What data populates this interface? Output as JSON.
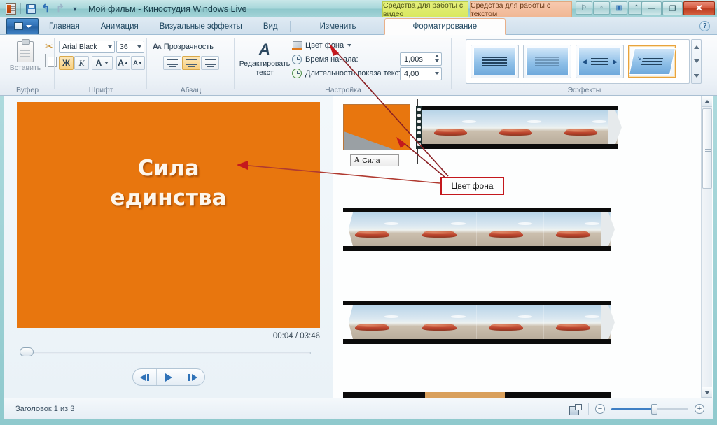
{
  "window": {
    "title": "Мой фильм - Киностудия Windows Live",
    "quick_access": [
      "save-icon",
      "undo-icon",
      "redo-icon",
      "customize-caret-icon"
    ],
    "controls": {
      "pin": "pin-icon",
      "restore_small": "restore-small-icon",
      "display": "display-icon",
      "collapse_ribbon": "collapse-ribbon-icon",
      "minimize": "—",
      "maximize": "❐",
      "close": "✕"
    }
  },
  "contextual_tabs": [
    {
      "label": "Средства для работы с видео",
      "color": "#d9e85f"
    },
    {
      "label": "Средства для работы с текстом",
      "color": "#f0b794"
    }
  ],
  "tabs": [
    {
      "label": "Главная",
      "active": false
    },
    {
      "label": "Анимация",
      "active": false
    },
    {
      "label": "Визуальные эффекты",
      "active": false
    },
    {
      "label": "Вид",
      "active": false
    },
    {
      "label": "Изменить",
      "active": false
    },
    {
      "label": "Форматирование",
      "active": true
    }
  ],
  "help_icon": "?",
  "ribbon": {
    "groups": [
      {
        "label": "Буфер"
      },
      {
        "label": "Шрифт"
      },
      {
        "label": "Абзац"
      },
      {
        "label": "Настройка"
      },
      {
        "label": "Эффекты"
      }
    ],
    "clipboard": {
      "paste_label": "Вставить",
      "cut_icon": "scissors-icon",
      "copy_icon": "copy-icon"
    },
    "font": {
      "font_name": "Arial Black",
      "font_size": "36",
      "bold_label": "Ж",
      "italic_label": "К",
      "font_color_label": "A",
      "grow_label": "A",
      "shrink_label": "A",
      "bold_active": true
    },
    "paragraph": {
      "transparency_label": "Прозрачность",
      "align_left": "align-left-icon",
      "align_center": "align-center-icon",
      "align_right": "align-right-icon",
      "align_center_active": true
    },
    "settings": {
      "edit_text_line1": "Редактировать",
      "edit_text_line2": "текст",
      "bg_color_label": "Цвет фона",
      "start_time_label": "Время начала:",
      "start_time_value": "1,00s",
      "duration_label": "Длительность показа текста:",
      "duration_value": "4,00"
    },
    "effects": {
      "items": [
        "effect-none",
        "effect-fade",
        "effect-slide-in-out",
        "effect-diagonal"
      ],
      "selected_index": 3
    }
  },
  "preview": {
    "video_text_line1": "Сила",
    "video_text_line2": "единства",
    "background_color": "#E8760E",
    "time_display": "00:04 / 03:46",
    "transport": {
      "previous": "previous-frame-icon",
      "play": "play-icon",
      "next": "next-frame-icon"
    }
  },
  "storyboard": {
    "title_clip_label": "Сила",
    "title_clip_icon": "text-A-icon",
    "rows": [
      {
        "frames": 3,
        "leading_notch": false
      },
      {
        "frames": 4,
        "leading_notch": true
      },
      {
        "frames": 4,
        "leading_notch": true
      }
    ]
  },
  "annotations": [
    {
      "label": "Цвет фона",
      "border_color": "#c4181d"
    }
  ],
  "status": {
    "text": "Заголовок 1 из 3",
    "thumb_view_icon": "thumbnail-view-icon",
    "zoom_out_label": "−",
    "zoom_in_label": "+"
  }
}
